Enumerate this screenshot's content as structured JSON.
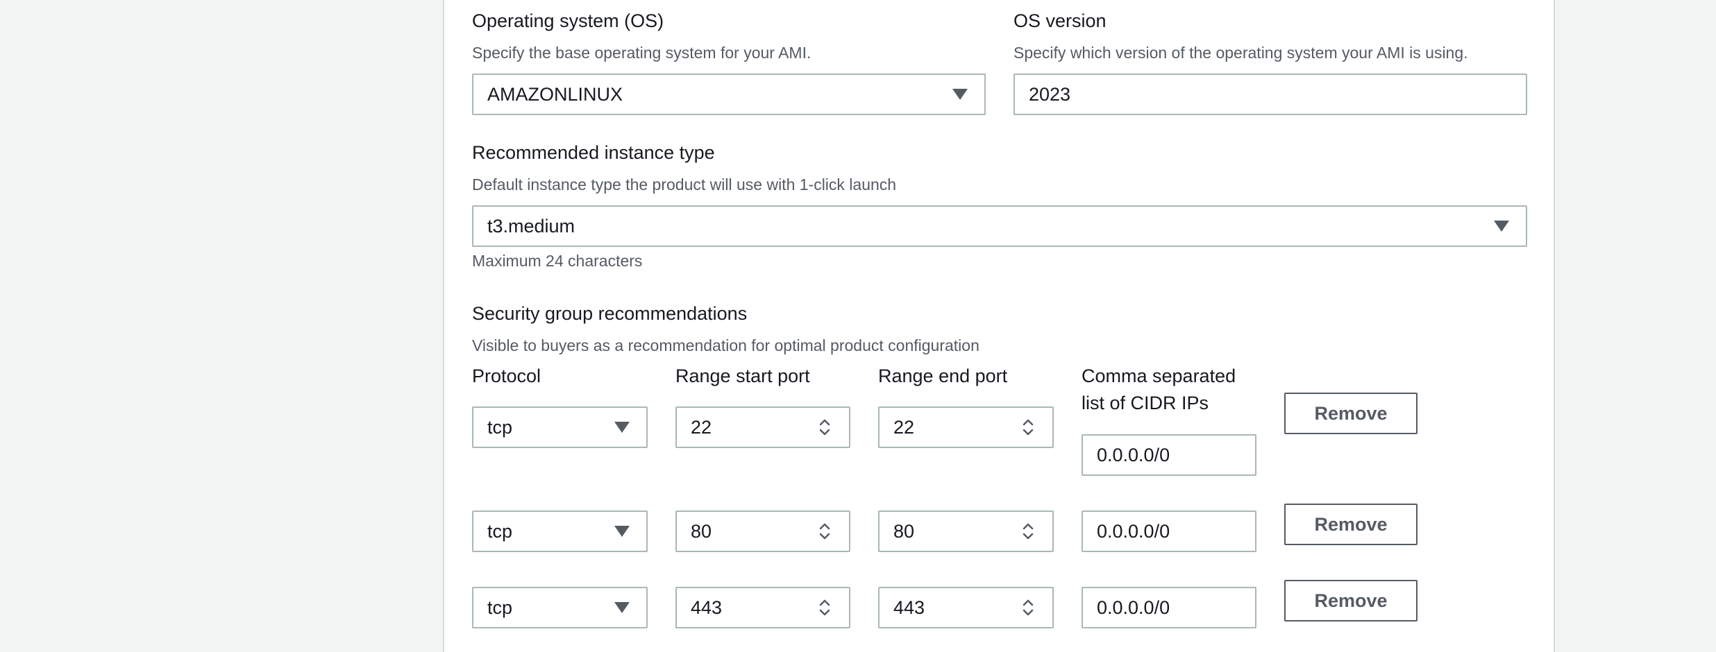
{
  "os": {
    "label": "Operating system (OS)",
    "description": "Specify the base operating system for your AMI.",
    "value": "AMAZONLINUX"
  },
  "os_version": {
    "label": "OS version",
    "description": "Specify which version of the operating system your AMI is using.",
    "value": "2023"
  },
  "instance_type": {
    "label": "Recommended instance type",
    "description": "Default instance type the product will use with 1-click launch",
    "value": "t3.medium",
    "constraint": "Maximum 24 characters"
  },
  "security_groups": {
    "label": "Security group recommendations",
    "description": "Visible to buyers as a recommendation for optimal product configuration",
    "columns": {
      "protocol": "Protocol",
      "start_port": "Range start port",
      "end_port": "Range end port",
      "cidr_line1": "Comma separated",
      "cidr_line2": "list of CIDR IPs"
    },
    "remove_label": "Remove",
    "rows": [
      {
        "protocol": "tcp",
        "start": "22",
        "end": "22",
        "cidr": "0.0.0.0/0"
      },
      {
        "protocol": "tcp",
        "start": "80",
        "end": "80",
        "cidr": "0.0.0.0/0"
      },
      {
        "protocol": "tcp",
        "start": "443",
        "end": "443",
        "cidr": "0.0.0.0/0"
      }
    ]
  },
  "colors": {
    "page_background": "#f2f3f3",
    "panel_background": "#ffffff",
    "input_border": "#aab7b8",
    "secondary_text": "#545b64",
    "primary_text": "#16191f"
  },
  "icons": {
    "select_caret": "caret-down-icon",
    "number_spinner": "spinner-icon"
  }
}
